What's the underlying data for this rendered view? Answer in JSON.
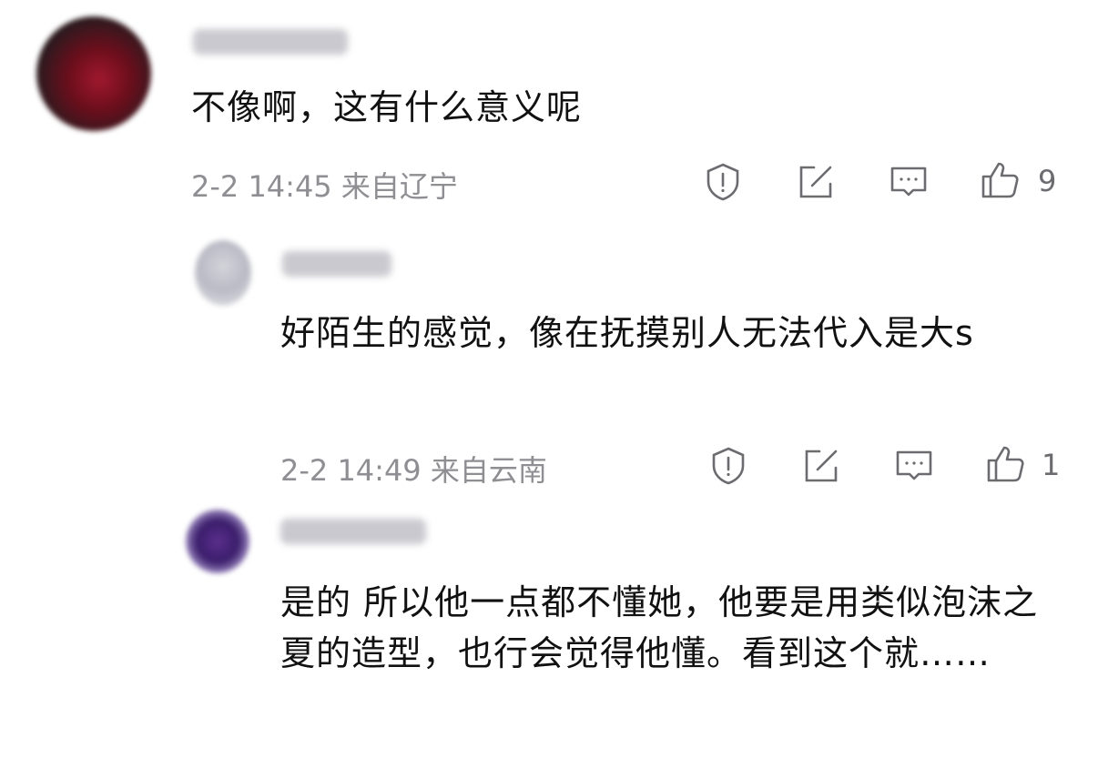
{
  "comments": [
    {
      "text": "不像啊，这有什么意义呢",
      "meta": "2-2 14:45 来自辽宁",
      "likes": "9"
    },
    {
      "text": "好陌生的感觉，像在抚摸别人无法代入是大s",
      "meta": "2-2 14:49 来自云南",
      "likes": "1"
    },
    {
      "text": "是的  所以他一点都不懂她，他要是用类似泡沫之夏的造型，也行会觉得他懂。看到这个就……"
    }
  ],
  "icons": {
    "report": "report-icon",
    "share": "share-edit-icon",
    "reply": "reply-comment-icon",
    "like": "thumbs-up-icon"
  },
  "colors": {
    "text": "#111111",
    "meta": "#8e8e93",
    "icon": "#6b6b70"
  }
}
